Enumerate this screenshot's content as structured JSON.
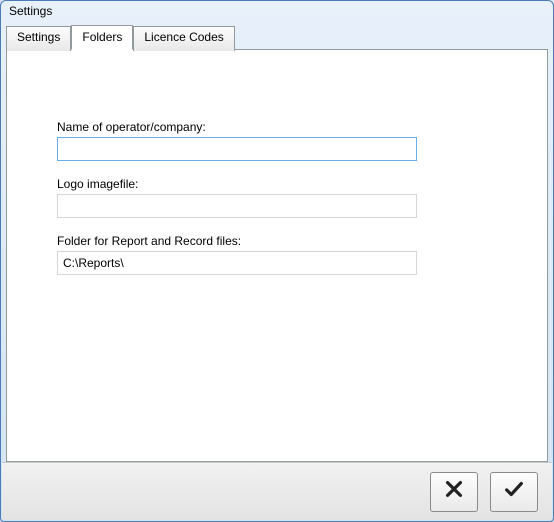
{
  "window": {
    "title": "Settings"
  },
  "tabs": [
    {
      "label": "Settings",
      "active": false
    },
    {
      "label": "Folders",
      "active": true
    },
    {
      "label": "Licence Codes",
      "active": false
    }
  ],
  "fields": {
    "operator": {
      "label": "Name of operator/company:",
      "value": ""
    },
    "logo": {
      "label": "Logo imagefile:",
      "value": ""
    },
    "reportFolder": {
      "label": "Folder for Report and Record files:",
      "value": "C:\\Reports\\"
    }
  },
  "buttons": {
    "cancel_icon": "cross",
    "ok_icon": "check"
  }
}
